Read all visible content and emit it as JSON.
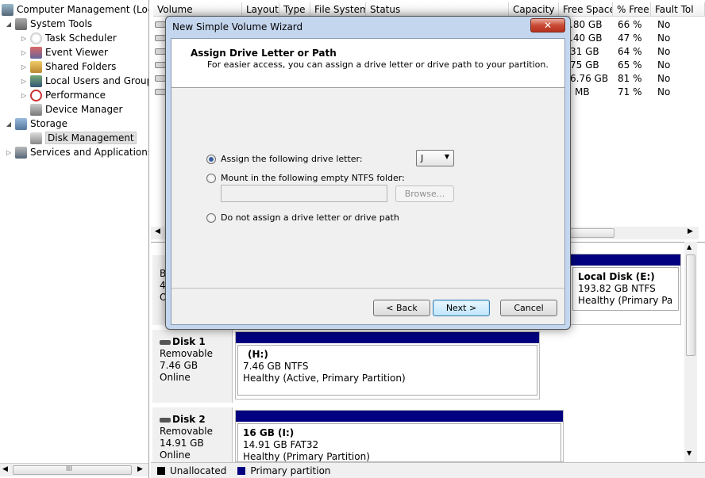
{
  "tree": {
    "root": "Computer Management (Local",
    "items": [
      {
        "label": "System Tools"
      },
      {
        "label": "Task Scheduler"
      },
      {
        "label": "Event Viewer"
      },
      {
        "label": "Shared Folders"
      },
      {
        "label": "Local Users and Groups"
      },
      {
        "label": "Performance"
      },
      {
        "label": "Device Manager"
      },
      {
        "label": "Storage"
      },
      {
        "label": "Disk Management"
      },
      {
        "label": "Services and Applications"
      }
    ],
    "scroll_glyph": "III"
  },
  "volume_table": {
    "columns": [
      "Volume",
      "Layout",
      "Type",
      "File System",
      "Status",
      "Capacity",
      "Free Space",
      "% Free",
      "Fault Tol"
    ],
    "rows": [
      {
        "free": ".80 GB",
        "pct": "66 %",
        "fault": "No"
      },
      {
        "free": ".40 GB",
        "pct": "47 %",
        "fault": "No"
      },
      {
        "free": "31 GB",
        "pct": "64 %",
        "fault": "No"
      },
      {
        "free": "75 GB",
        "pct": "65 %",
        "fault": "No"
      },
      {
        "free": "6.76 GB",
        "pct": "81 %",
        "fault": "No"
      },
      {
        "free": "MB",
        "pct": "71 %",
        "fault": "No"
      }
    ]
  },
  "disks": {
    "disk0_partial": {
      "l1": "B",
      "l2": "4",
      "l3": "O",
      "part_name": "Local Disk  (E:)",
      "part_size": "193.82 GB NTFS",
      "part_status": "Healthy (Primary Partiti"
    },
    "disk1": {
      "name": "Disk 1",
      "type": "Removable",
      "size": "7.46 GB",
      "state": "Online",
      "part_name": "(H:)",
      "part_size": "7.46 GB NTFS",
      "part_status": "Healthy (Active, Primary Partition)"
    },
    "disk2": {
      "name": "Disk 2",
      "type": "Removable",
      "size": "14.91 GB",
      "state": "Online",
      "part_name": "16 GB  (I:)",
      "part_size": "14.91 GB FAT32",
      "part_status": "Healthy (Primary Partition)"
    }
  },
  "legend": {
    "unallocated": "Unallocated",
    "primary": "Primary partition",
    "unallocated_color": "#000000",
    "primary_color": "#000080"
  },
  "wizard": {
    "title": "New Simple Volume Wizard",
    "close_glyph": "✕",
    "heading": "Assign Drive Letter or Path",
    "subheading": "For easier access, you can assign a drive letter or drive path to your partition.",
    "opt_letter": "Assign the following drive letter:",
    "opt_mount": "Mount in the following empty NTFS folder:",
    "opt_none": "Do not assign a drive letter or drive path",
    "selected_option": "letter",
    "drive_letter": "J",
    "browse": "Browse...",
    "back": "< Back",
    "next": "Next >",
    "cancel": "Cancel"
  }
}
